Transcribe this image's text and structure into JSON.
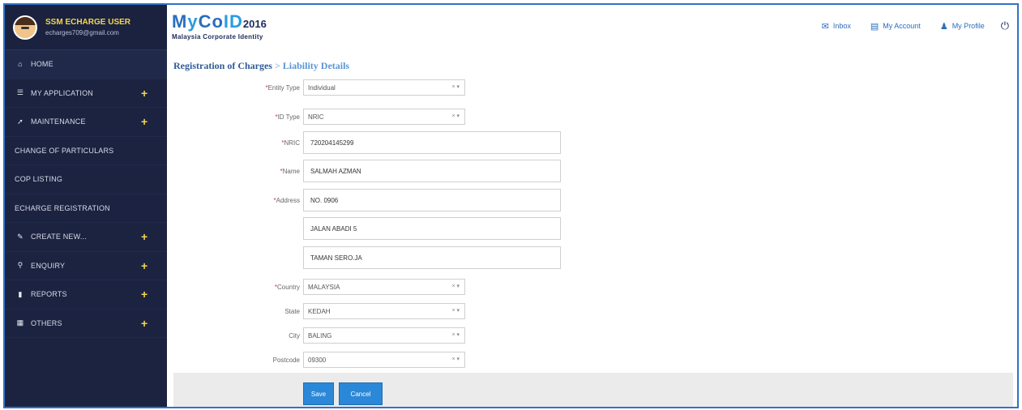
{
  "user": {
    "name": "SSM ECHARGE USER",
    "email": "echarges709@gmail.com"
  },
  "sidebar": {
    "items": [
      {
        "label": "HOME",
        "icon": "home-icon",
        "expand": ""
      },
      {
        "label": "MY APPLICATION",
        "icon": "list-icon",
        "expand": "+"
      },
      {
        "label": "MAINTENANCE",
        "icon": "wrench-icon",
        "expand": "+"
      },
      {
        "label": "CHANGE OF PARTICULARS",
        "icon": "",
        "expand": ""
      },
      {
        "label": "COP LISTING",
        "icon": "",
        "expand": ""
      },
      {
        "label": "ECHARGE REGISTRATION",
        "icon": "",
        "expand": ""
      },
      {
        "label": "CREATE NEW...",
        "icon": "edit-icon",
        "expand": "+"
      },
      {
        "label": "ENQUIRY",
        "icon": "search-icon",
        "expand": "+"
      },
      {
        "label": "REPORTS",
        "icon": "file-icon",
        "expand": "+"
      },
      {
        "label": "OTHERS",
        "icon": "calendar-icon",
        "expand": "+"
      }
    ]
  },
  "header": {
    "logo_prefix": "M",
    "logo_y": "y",
    "logo_co": "Co",
    "logo_id": "ID",
    "logo_year": "2016",
    "logo_tagline": "Malaysia Corporate Identity",
    "links": {
      "inbox": "Inbox",
      "my_account": "My Account",
      "my_profile": "My Profile"
    }
  },
  "breadcrumb": {
    "root": "Registration of Charges",
    "separator": ">",
    "leaf": "Liability Details"
  },
  "form": {
    "entity_type": {
      "label": "Entity Type",
      "value": "Individual"
    },
    "id_type": {
      "label": "ID Type",
      "value": "NRIC"
    },
    "nric": {
      "label": "NRIC",
      "value": "720204145299"
    },
    "name": {
      "label": "Name",
      "value": "SALMAH AZMAN"
    },
    "address": {
      "label": "Address",
      "line1": "NO. 0906",
      "line2": "JALAN ABADI 5",
      "line3": "TAMAN SERO.JA"
    },
    "country": {
      "label": "Country",
      "value": "MALAYSIA"
    },
    "state": {
      "label": "State",
      "value": "KEDAH"
    },
    "city": {
      "label": "City",
      "value": "BALING"
    },
    "postcode": {
      "label": "Postcode",
      "value": "09300"
    }
  },
  "buttons": {
    "save": "Save",
    "cancel": "Cancel"
  },
  "colors": {
    "sidebar_bg": "#1b2341",
    "accent_yellow": "#f5d64a",
    "brand_blue": "#2a6ebd",
    "button_blue": "#2b88d8"
  }
}
